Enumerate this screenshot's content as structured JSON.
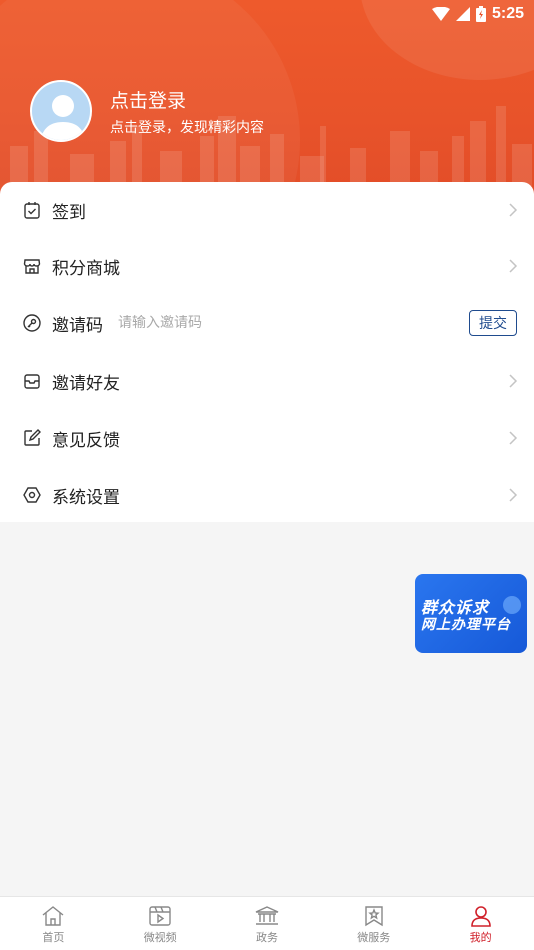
{
  "status_bar": {
    "time": "5:25"
  },
  "profile": {
    "title": "点击登录",
    "subtitle": "点击登录，发现精彩内容"
  },
  "menu": {
    "items": [
      {
        "label": "签到",
        "icon": "check-in-icon"
      },
      {
        "label": "积分商城",
        "icon": "store-icon"
      },
      {
        "label": "邀请码",
        "icon": "key-icon",
        "placeholder": "请输入邀请码",
        "button": "提交"
      },
      {
        "label": "邀请好友",
        "icon": "inbox-icon"
      },
      {
        "label": "意见反馈",
        "icon": "edit-icon"
      },
      {
        "label": "系统设置",
        "icon": "settings-icon"
      }
    ]
  },
  "float_banner": {
    "line1": "群众诉求",
    "line2": "网上办理平台"
  },
  "tabbar": {
    "tabs": [
      {
        "label": "首页",
        "icon": "home-icon"
      },
      {
        "label": "微视频",
        "icon": "video-icon"
      },
      {
        "label": "政务",
        "icon": "government-icon"
      },
      {
        "label": "微服务",
        "icon": "service-icon"
      },
      {
        "label": "我的",
        "icon": "user-icon",
        "active": true
      }
    ]
  },
  "colors": {
    "header": "#e8532a",
    "active_tab": "#d0202a",
    "submit_border": "#1f4b8e",
    "banner": "#1d63e0"
  }
}
